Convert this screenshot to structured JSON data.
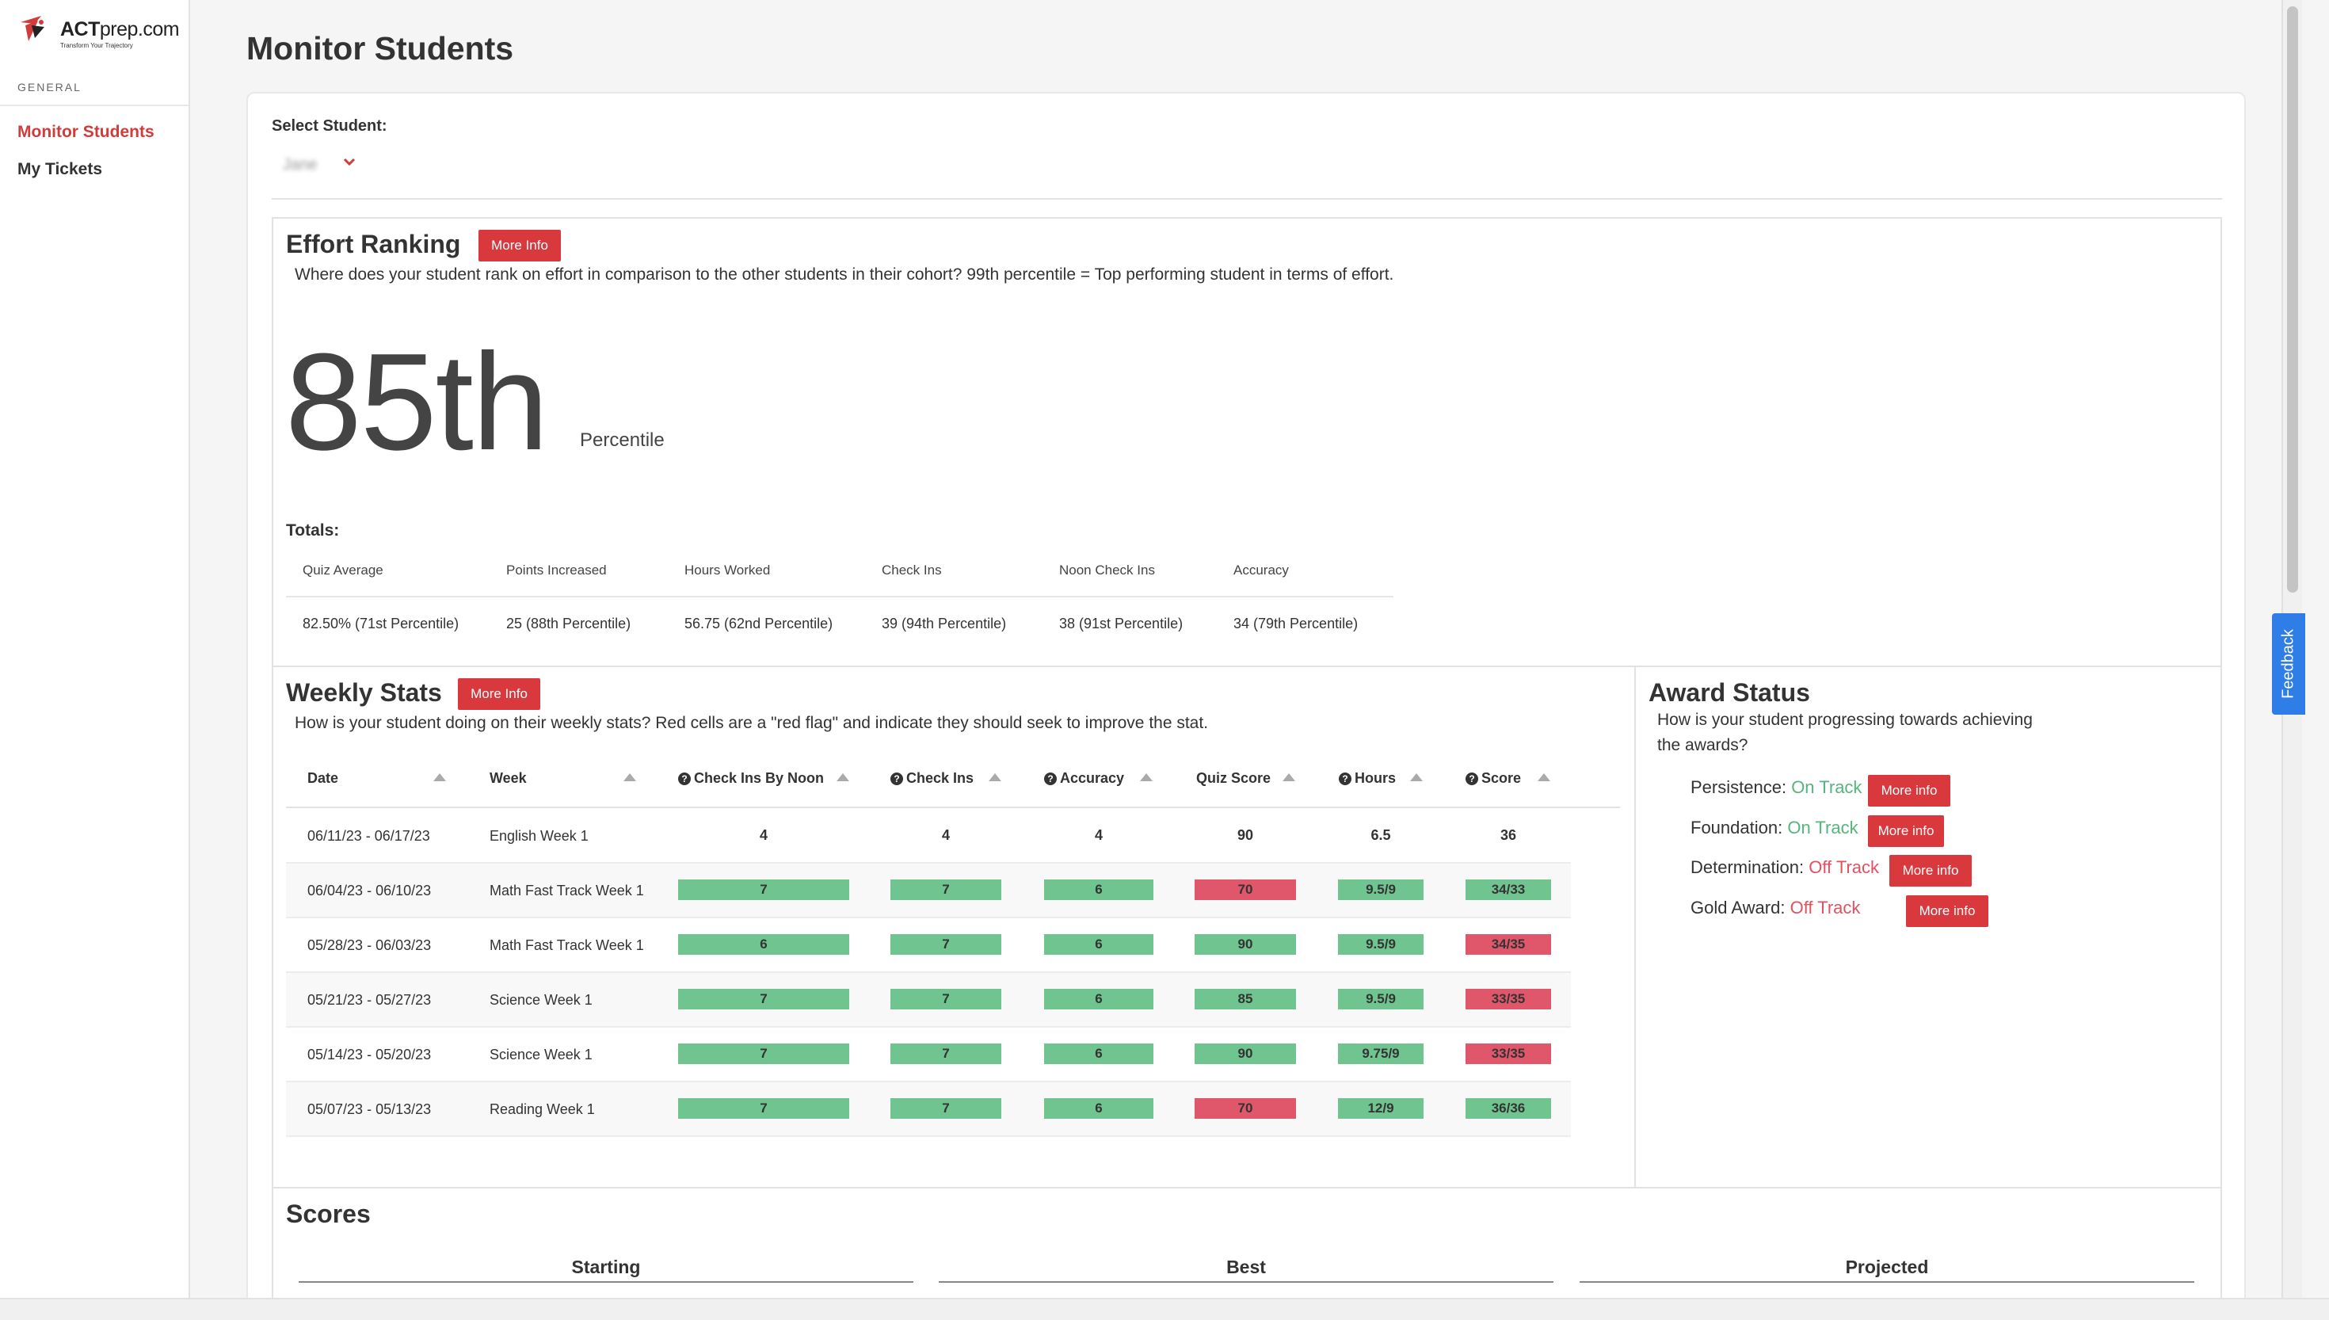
{
  "brand": {
    "name_bold": "ACT",
    "name_rest": "prep.com",
    "tagline": "Transform Your Trajectory"
  },
  "sidebar": {
    "section": "GENERAL",
    "items": [
      {
        "label": "Monitor Students",
        "active": true
      },
      {
        "label": "My Tickets",
        "active": false
      }
    ]
  },
  "page": {
    "title": "Monitor Students"
  },
  "student_select": {
    "label": "Select Student:",
    "value": "Jane",
    "icon": "chevron-down-icon"
  },
  "effort": {
    "title": "Effort Ranking",
    "more_info": "More Info",
    "description": "Where does your student rank on effort in comparison to the other students in their cohort? 99th percentile = Top performing student in terms of effort.",
    "rank": "85th",
    "unit": "Percentile",
    "totals_label": "Totals:",
    "totals": [
      {
        "header": "Quiz Average",
        "value": "82.50% (71st Percentile)"
      },
      {
        "header": "Points Increased",
        "value": "25 (88th Percentile)"
      },
      {
        "header": "Hours Worked",
        "value": "56.75 (62nd Percentile)"
      },
      {
        "header": "Check Ins",
        "value": "39 (94th Percentile)"
      },
      {
        "header": "Noon Check Ins",
        "value": "38 (91st Percentile)"
      },
      {
        "header": "Accuracy",
        "value": "34 (79th Percentile)"
      }
    ]
  },
  "weekly": {
    "title": "Weekly Stats",
    "more_info": "More Info",
    "description": "How is your student doing on their weekly stats? Red cells are a \"red flag\" and indicate they should seek to improve the stat.",
    "columns": [
      "Date",
      "Week",
      "Check Ins By Noon",
      "Check Ins",
      "Accuracy",
      "Quiz Score",
      "Hours",
      "Score"
    ],
    "rows": [
      {
        "date": "06/11/23 - 06/17/23",
        "week": "English Week 1",
        "noon": "4",
        "checkins": "4",
        "accuracy": "4",
        "quiz": "90",
        "hours": "6.5",
        "score": "36",
        "flags": [
          "none",
          "none",
          "none",
          "none",
          "none",
          "none"
        ]
      },
      {
        "date": "06/04/23 - 06/10/23",
        "week": "Math Fast Track Week 1",
        "noon": "7",
        "checkins": "7",
        "accuracy": "6",
        "quiz": "70",
        "hours": "9.5/9",
        "score": "34/33",
        "flags": [
          "good",
          "good",
          "good",
          "bad",
          "good",
          "good"
        ]
      },
      {
        "date": "05/28/23 - 06/03/23",
        "week": "Math Fast Track Week 1",
        "noon": "6",
        "checkins": "7",
        "accuracy": "6",
        "quiz": "90",
        "hours": "9.5/9",
        "score": "34/35",
        "flags": [
          "good",
          "good",
          "good",
          "good",
          "good",
          "bad"
        ]
      },
      {
        "date": "05/21/23 - 05/27/23",
        "week": "Science Week 1",
        "noon": "7",
        "checkins": "7",
        "accuracy": "6",
        "quiz": "85",
        "hours": "9.5/9",
        "score": "33/35",
        "flags": [
          "good",
          "good",
          "good",
          "good",
          "good",
          "bad"
        ]
      },
      {
        "date": "05/14/23 - 05/20/23",
        "week": "Science Week 1",
        "noon": "7",
        "checkins": "7",
        "accuracy": "6",
        "quiz": "90",
        "hours": "9.75/9",
        "score": "33/35",
        "flags": [
          "good",
          "good",
          "good",
          "good",
          "good",
          "bad"
        ]
      },
      {
        "date": "05/07/23 - 05/13/23",
        "week": "Reading Week 1",
        "noon": "7",
        "checkins": "7",
        "accuracy": "6",
        "quiz": "70",
        "hours": "12/9",
        "score": "36/36",
        "flags": [
          "good",
          "good",
          "good",
          "bad",
          "good",
          "good"
        ]
      }
    ]
  },
  "awards": {
    "title": "Award Status",
    "description_line1": "How is your student progressing towards achieving",
    "description_line2": "the awards?",
    "items": [
      {
        "label": "Persistence:",
        "status": "On Track",
        "on_track": true,
        "button": "More info"
      },
      {
        "label": "Foundation:",
        "status": "On Track",
        "on_track": true,
        "button": "More info"
      },
      {
        "label": "Determination:",
        "status": "Off Track",
        "on_track": false,
        "button": "More info"
      },
      {
        "label": "Gold Award:",
        "status": "Off Track",
        "on_track": false,
        "button": "More info"
      }
    ]
  },
  "scores": {
    "title": "Scores",
    "columns": [
      "Starting",
      "Best",
      "Projected"
    ]
  },
  "feedback": "Feedback",
  "colors": {
    "accent": "#d23b3b",
    "button": "#d9383d",
    "good": "#6fc48f",
    "bad": "#e0566a",
    "on_track": "#55b57c",
    "off_track": "#e2515f",
    "feedback": "#2f7ee8"
  }
}
